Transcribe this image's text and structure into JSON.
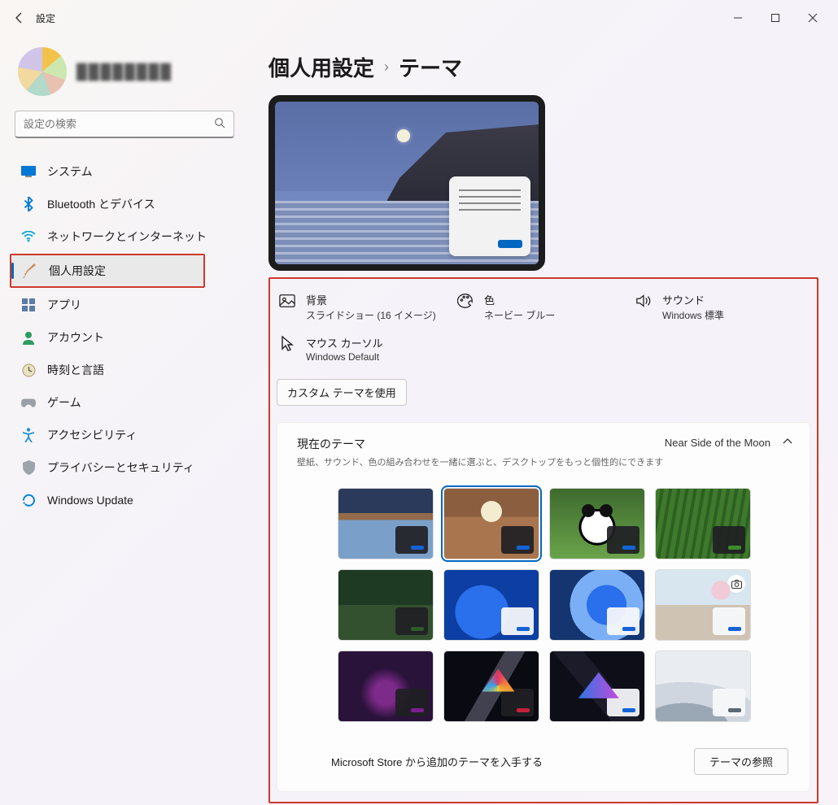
{
  "app_title": "設定",
  "search_placeholder": "設定の検索",
  "breadcrumb": {
    "parent": "個人用設定",
    "child": "テーマ"
  },
  "nav": [
    {
      "id": "system",
      "label": "システム"
    },
    {
      "id": "bluetooth",
      "label": "Bluetooth とデバイス"
    },
    {
      "id": "network",
      "label": "ネットワークとインターネット"
    },
    {
      "id": "personal",
      "label": "個人用設定",
      "selected": true
    },
    {
      "id": "apps",
      "label": "アプリ"
    },
    {
      "id": "accounts",
      "label": "アカウント"
    },
    {
      "id": "time",
      "label": "時刻と言語"
    },
    {
      "id": "gaming",
      "label": "ゲーム"
    },
    {
      "id": "access",
      "label": "アクセシビリティ"
    },
    {
      "id": "privacy",
      "label": "プライバシーとセキュリティ"
    },
    {
      "id": "update",
      "label": "Windows Update"
    }
  ],
  "settings": {
    "background": {
      "title": "背景",
      "subtitle": "スライドショー (16 イメージ)"
    },
    "color": {
      "title": "色",
      "subtitle": "ネービー ブルー"
    },
    "sound": {
      "title": "サウンド",
      "subtitle": "Windows 標準"
    },
    "cursor": {
      "title": "マウス カーソル",
      "subtitle": "Windows Default"
    },
    "custom_button": "カスタム テーマを使用"
  },
  "panel": {
    "heading": "現在のテーマ",
    "desc": "壁紙、サウンド、色の組み合わせを一緒に選ぶと、デスクトップをもっと個性的にできます",
    "current": "Near Side of the Moon"
  },
  "themes": [
    {
      "id": "beach",
      "accent": "#1463d6",
      "mini": "dark"
    },
    {
      "id": "moon",
      "accent": "#1463d6",
      "mini": "dark",
      "selected": true
    },
    {
      "id": "panda",
      "accent": "#1463d6",
      "mini": "dark"
    },
    {
      "id": "bamboo",
      "accent": "#3e8a2c",
      "mini": "dark"
    },
    {
      "id": "forest",
      "accent": "#2f5a2c",
      "mini": "dark"
    },
    {
      "id": "bloom1",
      "accent": "#1463d6",
      "mini": "light"
    },
    {
      "id": "bloom2",
      "accent": "#1463d6",
      "mini": "light"
    },
    {
      "id": "blossom",
      "accent": "#1463d6",
      "mini": "light",
      "camera": true
    },
    {
      "id": "glow",
      "accent": "#7a1f90",
      "mini": "dark"
    },
    {
      "id": "flow1",
      "accent": "#c4213b",
      "mini": "dark"
    },
    {
      "id": "flow2",
      "accent": "#1463d6",
      "mini": "light"
    },
    {
      "id": "wave",
      "accent": "#5a6876",
      "mini": "light"
    }
  ],
  "store": {
    "text": "Microsoft Store から追加のテーマを入手する",
    "button": "テーマの参照"
  }
}
